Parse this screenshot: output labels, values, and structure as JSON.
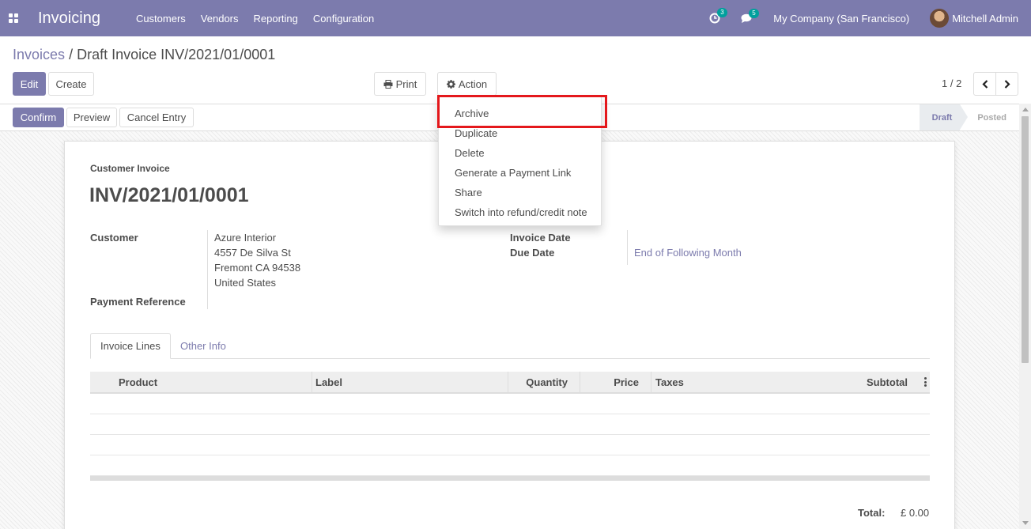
{
  "navbar": {
    "app_name": "Invoicing",
    "menu": [
      "Customers",
      "Vendors",
      "Reporting",
      "Configuration"
    ],
    "activity_count": "3",
    "message_count": "5",
    "company": "My Company (San Francisco)",
    "user": "Mitchell Admin"
  },
  "breadcrumb": {
    "parent": "Invoices",
    "separator": "/",
    "current": "Draft Invoice INV/2021/01/0001"
  },
  "buttons": {
    "edit": "Edit",
    "create": "Create",
    "print": "Print",
    "action": "Action",
    "confirm": "Confirm",
    "preview": "Preview",
    "cancel_entry": "Cancel Entry"
  },
  "pager": {
    "value": "1 / 2"
  },
  "status": {
    "draft": "Draft",
    "posted": "Posted"
  },
  "action_menu": {
    "items": [
      "Archive",
      "Duplicate",
      "Delete",
      "Generate a Payment Link",
      "Share",
      "Switch into refund/credit note"
    ]
  },
  "invoice": {
    "type_label": "Customer Invoice",
    "name": "INV/2021/01/0001",
    "customer_label": "Customer",
    "customer_name": "Azure Interior",
    "address": [
      "4557 De Silva St",
      "Fremont CA 94538",
      "United States"
    ],
    "payment_reference_label": "Payment Reference",
    "invoice_date_label": "Invoice Date",
    "due_date_label": "Due Date",
    "due_date_value": "End of Following Month"
  },
  "tabs": [
    "Invoice Lines",
    "Other Info"
  ],
  "table": {
    "columns": [
      "Product",
      "Label",
      "Quantity",
      "Price",
      "Taxes",
      "Subtotal"
    ],
    "rows": [
      [],
      [],
      [],
      []
    ]
  },
  "totals": {
    "label": "Total:",
    "value": "£ 0.00"
  },
  "colors": {
    "brand": "#7c7bad",
    "highlight": "#e4181c",
    "badge": "#00a09d"
  }
}
